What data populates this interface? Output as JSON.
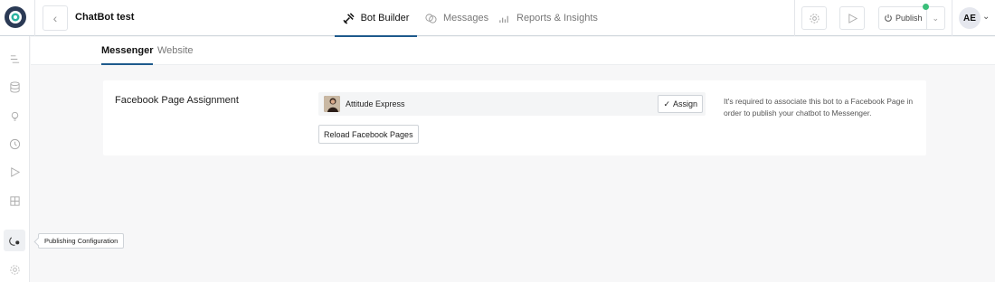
{
  "header": {
    "title": "ChatBot test",
    "tabs": [
      {
        "label": "Bot Builder",
        "icon": "tools-icon",
        "active": true
      },
      {
        "label": "Messages",
        "icon": "chat-bubbles-icon",
        "active": false
      },
      {
        "label": "Reports & Insights",
        "icon": "bar-chart-icon",
        "active": false
      }
    ],
    "publish_label": "Publish",
    "avatar_initials": "AE",
    "status_color": "#3bbf7a",
    "accent_color": "#1e5a8c"
  },
  "sidebar": {
    "items": [
      "flow-icon",
      "database-icon",
      "lightbulb-icon",
      "clock-icon",
      "play-icon",
      "grid-icon",
      "publishing-config-icon",
      "settings-icon"
    ],
    "tooltip": "Publishing Configuration"
  },
  "subtabs": [
    {
      "label": "Messenger",
      "active": true
    },
    {
      "label": "Website",
      "active": false
    }
  ],
  "facebook": {
    "section_label": "Facebook Page Assignment",
    "page_name": "Attitude Express",
    "assign_label": "Assign",
    "reload_label": "Reload Facebook Pages",
    "help_text": "It's required to associate this bot to a Facebook Page in order to publish your chatbot to Messenger."
  }
}
